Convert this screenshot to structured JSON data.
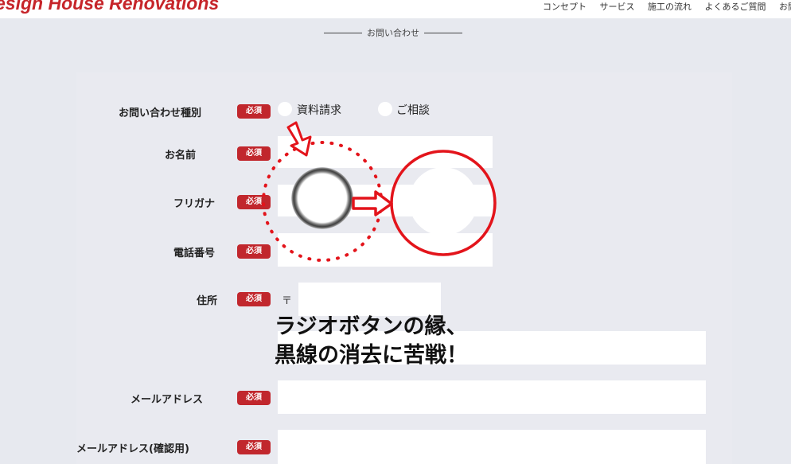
{
  "header": {
    "logo": "esign House Renovations",
    "nav": [
      "コンセプト",
      "サービス",
      "施工の流れ",
      "よくあるご質問",
      "お問い"
    ]
  },
  "section_title": "お問い合わせ",
  "form": {
    "required_badge": "必須",
    "inquiry_type": {
      "label": "お問い合わせ種別",
      "options": [
        "資料請求",
        "ご相談"
      ]
    },
    "name": {
      "label": "お名前"
    },
    "furigana": {
      "label": "フリガナ"
    },
    "phone": {
      "label": "電話番号"
    },
    "address": {
      "label": "住所",
      "postal_mark": "〒"
    },
    "email": {
      "label": "メールアドレス"
    },
    "email_confirm": {
      "label": "メールアドレス(確認用)"
    }
  },
  "annotation": {
    "line1": "ラジオボタンの縁、",
    "line2": "黒線の消去に苦戦！",
    "accent_color": "#e3141b"
  }
}
